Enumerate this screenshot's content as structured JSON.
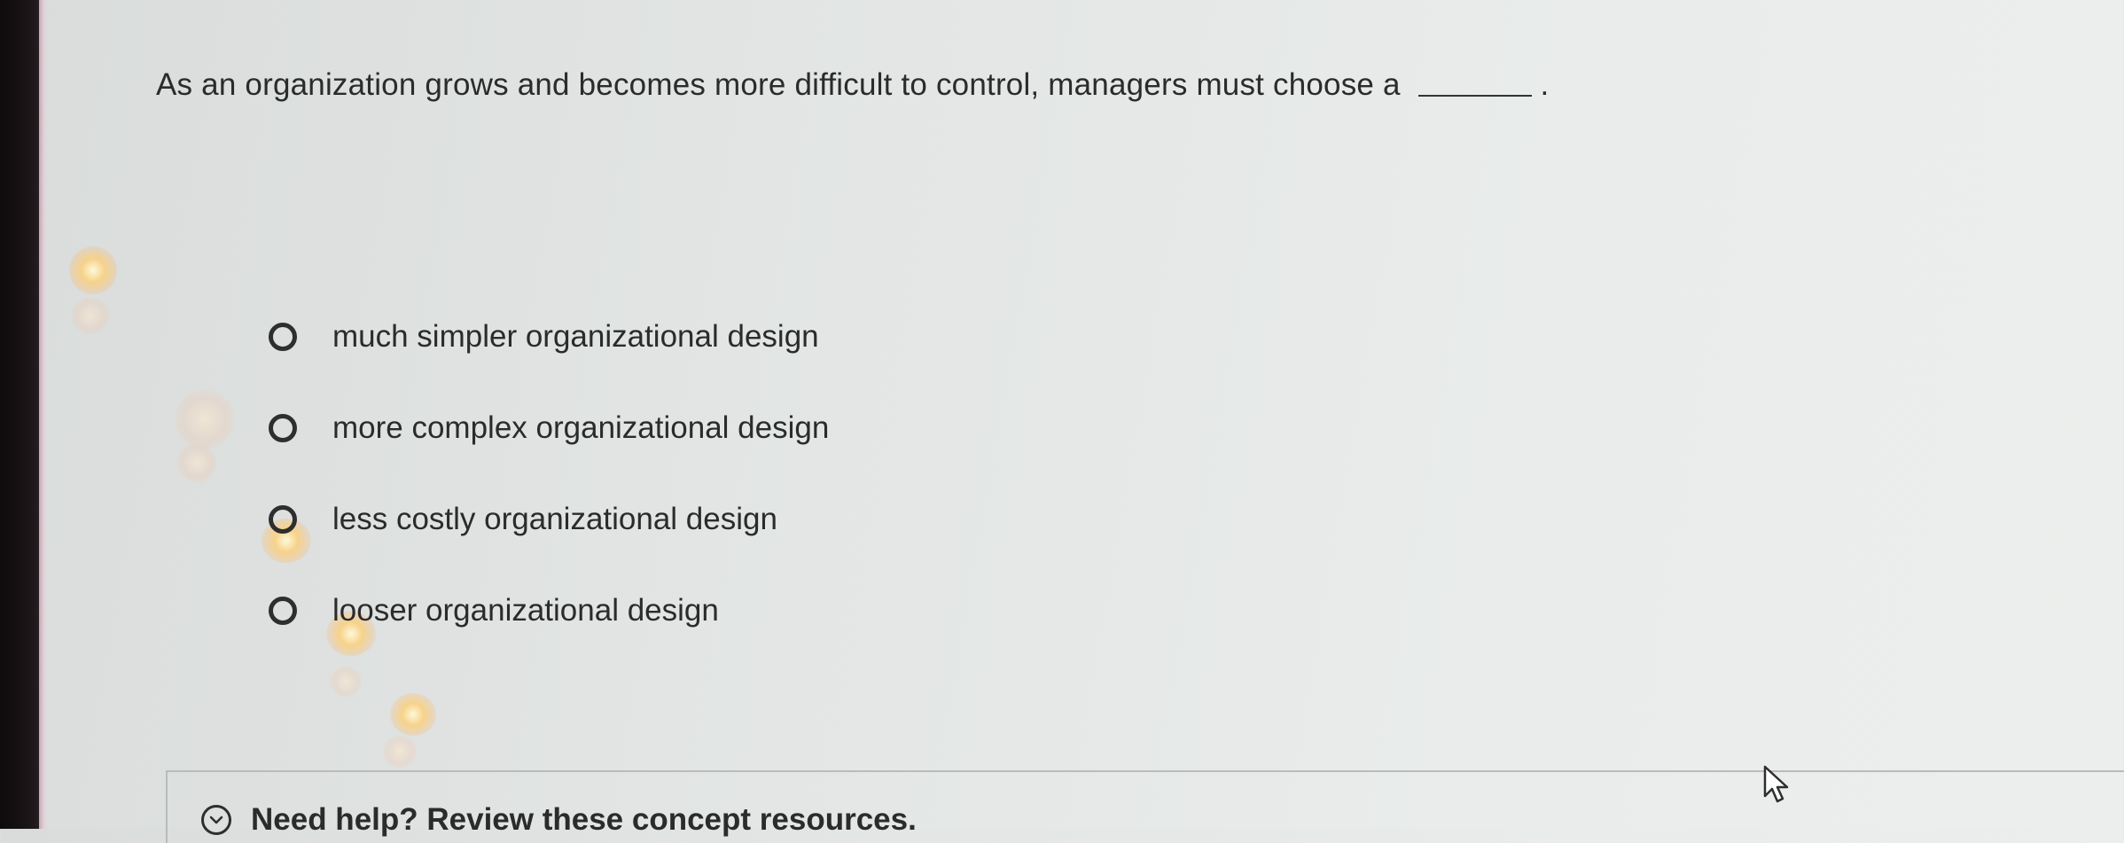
{
  "question": {
    "text": "As an organization grows and becomes more difficult to control, managers must choose a",
    "suffix": "."
  },
  "options": [
    {
      "label": "much simpler organizational design",
      "selected": false
    },
    {
      "label": "more complex organizational design",
      "selected": false
    },
    {
      "label": "less costly organizational design",
      "selected": false
    },
    {
      "label": "looser organizational design",
      "selected": false
    }
  ],
  "help": {
    "label": "Need help? Review these concept resources.",
    "icon": "chevron-down-circle-icon"
  },
  "colors": {
    "text": "#2b2b2b",
    "background": "#e4e7e6"
  }
}
